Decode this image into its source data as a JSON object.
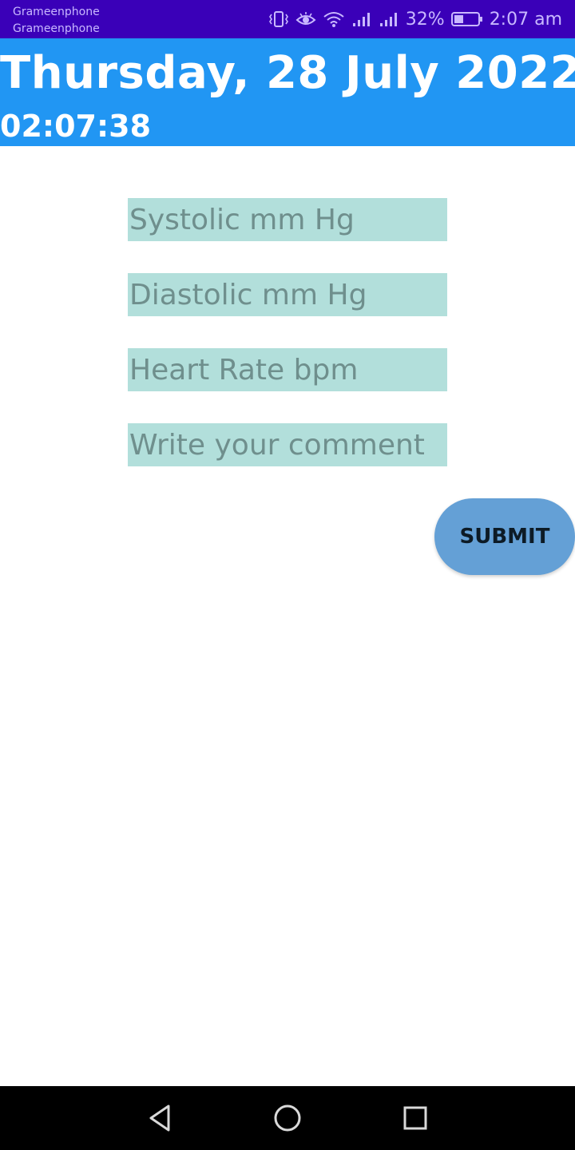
{
  "status_bar": {
    "carrier_1": "Grameenphone",
    "carrier_2": "Grameenphone",
    "battery": "32%",
    "clock": "2:07 am",
    "icons": [
      "vibrate-icon",
      "eye-icon",
      "wifi-icon",
      "signal-icon",
      "signal-icon",
      "battery-icon"
    ]
  },
  "header": {
    "date": "Thursday, 28 July 2022",
    "time": "02:07:38",
    "color": "#2196f3"
  },
  "form": {
    "systolic_placeholder": "Systolic mm Hg",
    "diastolic_placeholder": "Diastolic mm Hg",
    "heart_rate_placeholder": "Heart Rate bpm",
    "comment_placeholder": "Write your comment",
    "submit_label": "SUBMIT"
  },
  "nav_bar": {
    "icons": [
      "back-icon",
      "home-icon",
      "recents-icon"
    ]
  }
}
